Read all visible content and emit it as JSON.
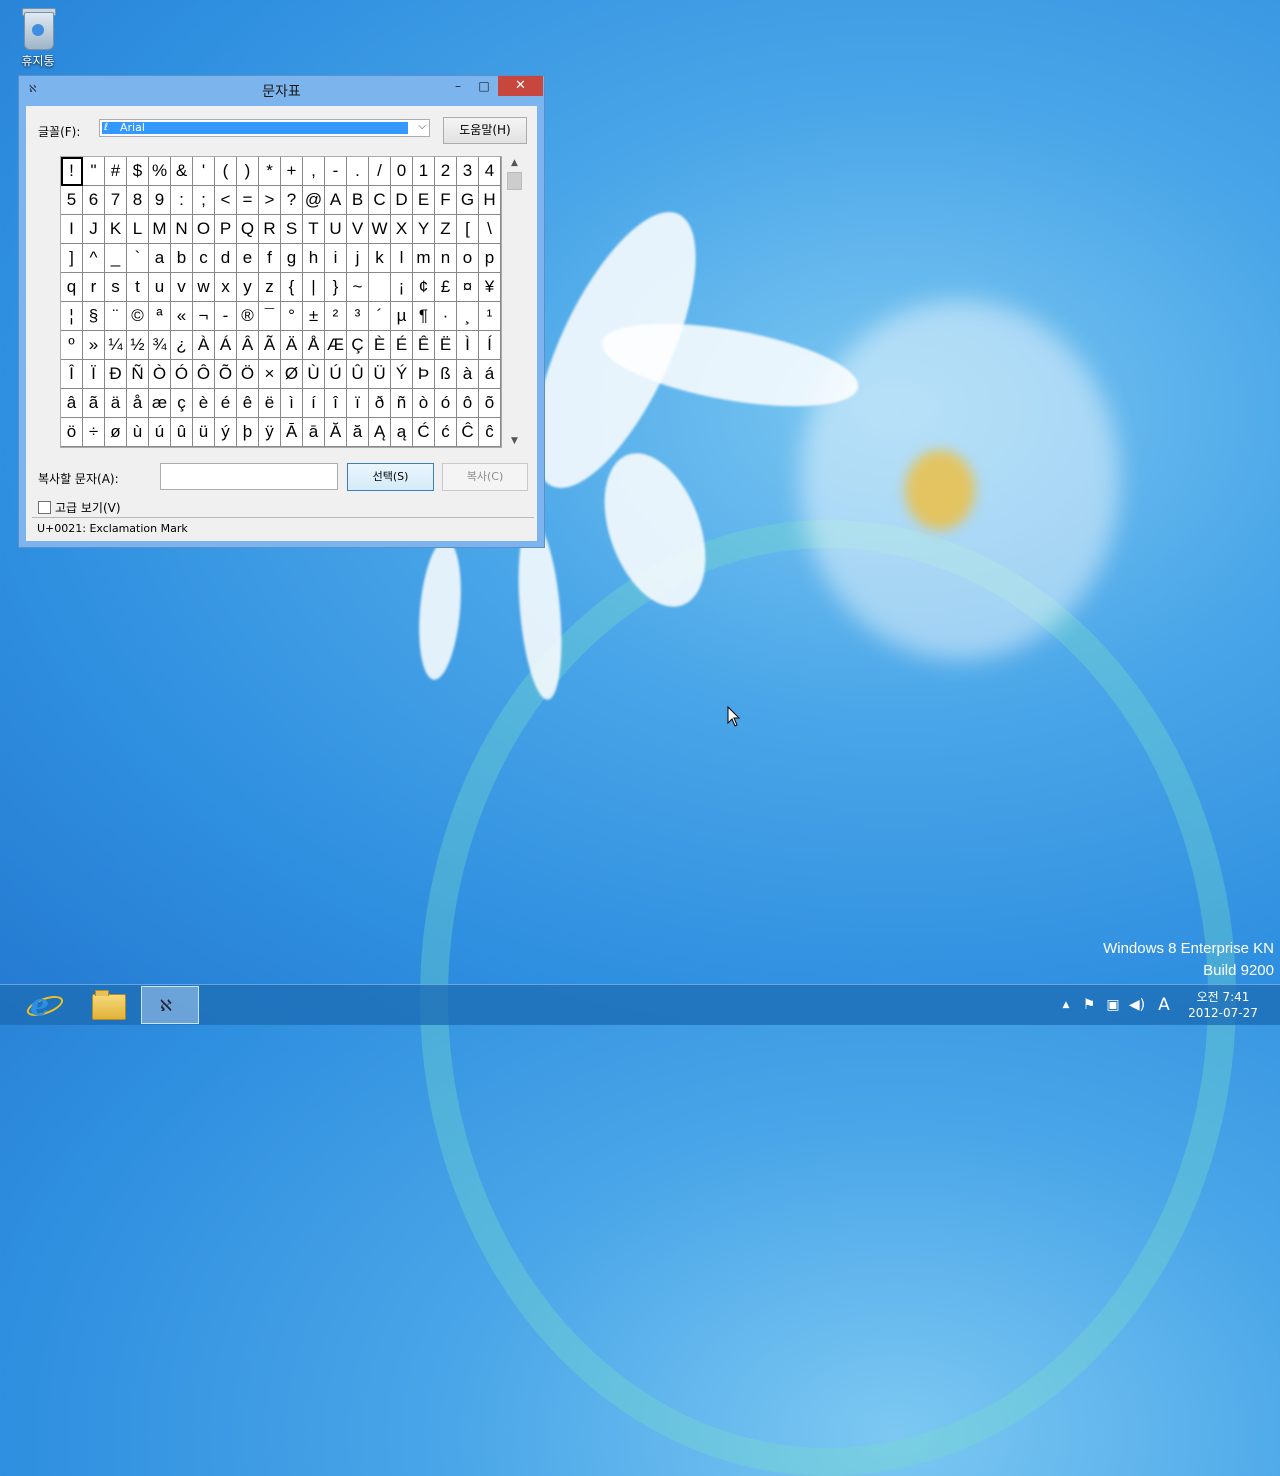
{
  "desktop": {
    "recycle_bin_label": "휴지통",
    "watermark_line1": "Windows 8 Enterprise KN",
    "watermark_line2": "Build 9200"
  },
  "window": {
    "title": "문자표",
    "minimize_glyph": "–",
    "maximize_glyph": "□",
    "close_glyph": "✕",
    "font_label": "글꼴(F):",
    "font_value": "Arial",
    "help_button": "도움말(H)",
    "chars": [
      "!",
      "\"",
      "#",
      "$",
      "%",
      "&",
      "'",
      "(",
      ")",
      "*",
      "+",
      ",",
      "-",
      ".",
      "/",
      "0",
      "1",
      "2",
      "3",
      "4",
      "5",
      "6",
      "7",
      "8",
      "9",
      ":",
      ";",
      "<",
      "=",
      ">",
      "?",
      "@",
      "A",
      "B",
      "C",
      "D",
      "E",
      "F",
      "G",
      "H",
      "I",
      "J",
      "K",
      "L",
      "M",
      "N",
      "O",
      "P",
      "Q",
      "R",
      "S",
      "T",
      "U",
      "V",
      "W",
      "X",
      "Y",
      "Z",
      "[",
      "\\",
      "]",
      "^",
      "_",
      "`",
      "a",
      "b",
      "c",
      "d",
      "e",
      "f",
      "g",
      "h",
      "i",
      "j",
      "k",
      "l",
      "m",
      "n",
      "o",
      "p",
      "q",
      "r",
      "s",
      "t",
      "u",
      "v",
      "w",
      "x",
      "y",
      "z",
      "{",
      "|",
      "}",
      "~",
      " ",
      "¡",
      "¢",
      "£",
      "¤",
      "¥",
      "¦",
      "§",
      "¨",
      "©",
      "ª",
      "«",
      "¬",
      "-",
      "®",
      "¯",
      "°",
      "±",
      "²",
      "³",
      "´",
      "µ",
      "¶",
      "·",
      "¸",
      "¹",
      "º",
      "»",
      "¼",
      "½",
      "¾",
      "¿",
      "À",
      "Á",
      "Â",
      "Ã",
      "Ä",
      "Å",
      "Æ",
      "Ç",
      "È",
      "É",
      "Ê",
      "Ë",
      "Ì",
      "Í",
      "Î",
      "Ï",
      "Ð",
      "Ñ",
      "Ò",
      "Ó",
      "Ô",
      "Õ",
      "Ö",
      "×",
      "Ø",
      "Ù",
      "Ú",
      "Û",
      "Ü",
      "Ý",
      "Þ",
      "ß",
      "à",
      "á",
      "â",
      "ã",
      "ä",
      "å",
      "æ",
      "ç",
      "è",
      "é",
      "ê",
      "ë",
      "ì",
      "í",
      "î",
      "ï",
      "ð",
      "ñ",
      "ò",
      "ó",
      "ô",
      "õ",
      "ö",
      "÷",
      "ø",
      "ù",
      "ú",
      "û",
      "ü",
      "ý",
      "þ",
      "ÿ",
      "Ā",
      "ā",
      "Ă",
      "ă",
      "Ą",
      "ą",
      "Ć",
      "ć",
      "Ĉ",
      "ĉ"
    ],
    "selected_index": 0,
    "copy_label": "복사할 문자(A):",
    "copy_value": "",
    "select_button": "선택(S)",
    "copy_button": "복사(C)",
    "advanced_label": "고급 보기(V)",
    "advanced_checked": false,
    "status_text": "U+0021: Exclamation Mark"
  },
  "taskbar": {
    "time": "오전 7:41",
    "date": "2012-07-27",
    "ime_glyph": "A",
    "tray_up_glyph": "▲",
    "flag_glyph": "⚑",
    "network_glyph": "▣",
    "volume_glyph": "◀)"
  },
  "colors": {
    "close_button": "#c7463e",
    "selection": "#3399ff",
    "window_frame": "#7cb4ee"
  }
}
